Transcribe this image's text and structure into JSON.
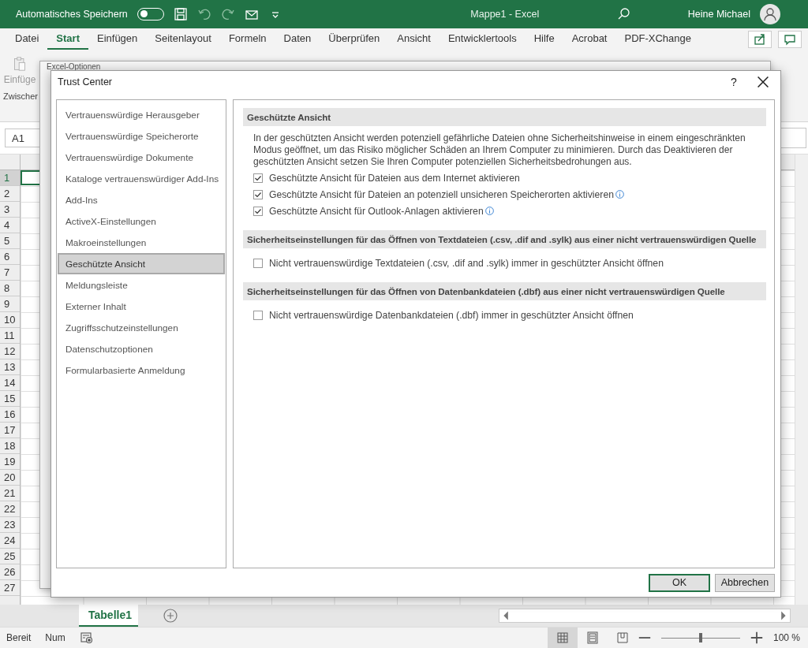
{
  "app": {
    "autosave_label": "Automatisches Speichern",
    "autosave_on": false,
    "title": "Mappe1  -  Excel",
    "user": "Heine Michael"
  },
  "ribbon_tabs": [
    {
      "label": "Datei",
      "selected": false
    },
    {
      "label": "Start",
      "selected": true
    },
    {
      "label": "Einfügen",
      "selected": false
    },
    {
      "label": "Seitenlayout",
      "selected": false
    },
    {
      "label": "Formeln",
      "selected": false
    },
    {
      "label": "Daten",
      "selected": false
    },
    {
      "label": "Überprüfen",
      "selected": false
    },
    {
      "label": "Ansicht",
      "selected": false
    },
    {
      "label": "Entwicklertools",
      "selected": false
    },
    {
      "label": "Hilfe",
      "selected": false
    },
    {
      "label": "Acrobat",
      "selected": false
    },
    {
      "label": "PDF-XChange",
      "selected": false
    }
  ],
  "clipboard": {
    "paste_label": "Einfüge",
    "group_label": "Zwischer"
  },
  "name_box": "A1",
  "row_headers": [
    "1",
    "2",
    "3",
    "4",
    "5",
    "6",
    "7",
    "8",
    "9",
    "10",
    "11",
    "12",
    "13",
    "14",
    "15",
    "16",
    "17",
    "18",
    "19",
    "20",
    "21",
    "22",
    "23",
    "24",
    "25",
    "26",
    "27"
  ],
  "sheet_tabs": [
    {
      "label": "Tabelle1",
      "selected": true
    }
  ],
  "status_bar": {
    "mode": "Bereit",
    "num": "Num",
    "zoom": "100 %",
    "zoom_slider": {
      "level": 0.5
    },
    "views": [
      {
        "kind": "normal",
        "selected": true
      },
      {
        "kind": "layout",
        "selected": false
      },
      {
        "kind": "pagebreak",
        "selected": false
      }
    ]
  },
  "back_dialog": {
    "title": "Excel-Optionen"
  },
  "dialog": {
    "title": "Trust Center",
    "help": "?",
    "categories": [
      {
        "label": "Vertrauenswürdige Herausgeber",
        "selected": false
      },
      {
        "label": "Vertrauenswürdige Speicherorte",
        "selected": false
      },
      {
        "label": "Vertrauenswürdige Dokumente",
        "selected": false
      },
      {
        "label": "Kataloge vertrauenswürdiger Add-Ins",
        "selected": false
      },
      {
        "label": "Add-Ins",
        "selected": false
      },
      {
        "label": "ActiveX-Einstellungen",
        "selected": false
      },
      {
        "label": "Makroeinstellungen",
        "selected": false
      },
      {
        "label": "Geschützte Ansicht",
        "selected": true
      },
      {
        "label": "Meldungsleiste",
        "selected": false
      },
      {
        "label": "Externer Inhalt",
        "selected": false
      },
      {
        "label": "Zugriffsschutzeinstellungen",
        "selected": false
      },
      {
        "label": "Datenschutzoptionen",
        "selected": false
      },
      {
        "label": "Formularbasierte Anmeldung",
        "selected": false
      }
    ],
    "sections": [
      {
        "heading": "Geschützte Ansicht",
        "description": "In der geschützten Ansicht werden potenziell gefährliche Dateien ohne Sicherheitshinweise in einem eingeschränkten Modus geöffnet, um das Risiko möglicher Schäden an Ihrem Computer zu minimieren. Durch das Deaktivieren der geschützten Ansicht setzen Sie Ihren Computer potenziellen Sicherheitsbedrohungen aus.",
        "options": [
          {
            "label": "Geschützte Ansicht für Dateien aus dem Internet aktivieren",
            "checked": true,
            "info": false
          },
          {
            "label": "Geschützte Ansicht für Dateien an potenziell unsicheren Speicherorten aktivieren",
            "checked": true,
            "info": true
          },
          {
            "label": "Geschützte Ansicht für Outlook-Anlagen aktivieren",
            "checked": true,
            "info": true
          }
        ]
      },
      {
        "heading": "Sicherheitseinstellungen für das Öffnen von Textdateien (.csv, .dif and .sylk) aus einer nicht vertrauenswürdigen Quelle",
        "options": [
          {
            "label": "Nicht vertrauenswürdige Textdateien (.csv, .dif and .sylk) immer in geschützter Ansicht öffnen",
            "checked": false,
            "info": false
          }
        ]
      },
      {
        "heading": "Sicherheitseinstellungen für das Öffnen von Datenbankdateien (.dbf) aus einer nicht vertrauenswürdigen Quelle",
        "options": [
          {
            "label": "Nicht vertrauenswürdige Datenbankdateien (.dbf) immer in geschützter Ansicht öffnen",
            "checked": false,
            "info": false
          }
        ]
      }
    ],
    "buttons": [
      {
        "label": "OK",
        "default": true
      },
      {
        "label": "Abbrechen",
        "default": false
      }
    ]
  }
}
